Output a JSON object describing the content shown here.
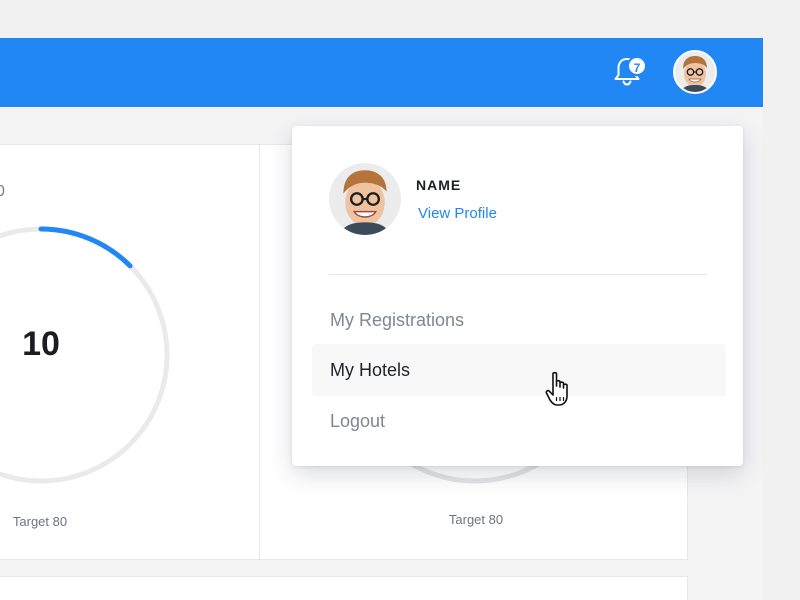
{
  "header": {
    "notification_count": "7",
    "brand_color": "#2187f5"
  },
  "dashboard": {
    "card1": {
      "label_partial": "0",
      "value": "10",
      "target": "Target 80",
      "progress_fraction": 0.125
    },
    "card2": {
      "target": "Target 80"
    }
  },
  "profile_menu": {
    "name": "NAME",
    "view_profile": "View Profile",
    "items": [
      {
        "label": "My Registrations"
      },
      {
        "label": "My Hotels"
      },
      {
        "label": "Logout"
      }
    ]
  }
}
